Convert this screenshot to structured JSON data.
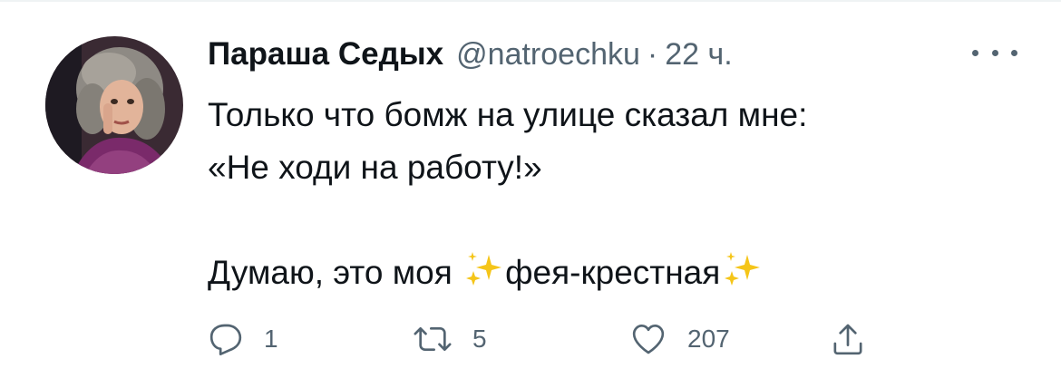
{
  "tweet": {
    "author": {
      "display_name": "Параша Седых",
      "handle": "@natroechku",
      "separator": "·",
      "time": "22 ч."
    },
    "text": {
      "line1": "Только что бомж на улице сказал мне:",
      "line2": "«Не ходи на работу!»",
      "line3_before": "Думаю, это моя ",
      "line3_middle": "фея-крестная",
      "sparkle_emoji": "✨"
    },
    "actions": {
      "replies": "1",
      "retweets": "5",
      "likes": "207"
    },
    "icons": [
      "more-icon",
      "reply-icon",
      "retweet-icon",
      "like-icon",
      "share-icon",
      "sparkles-icon"
    ],
    "colors": {
      "text": "#0f1419",
      "secondary": "#536471",
      "sparkle": "#f5c518"
    }
  }
}
